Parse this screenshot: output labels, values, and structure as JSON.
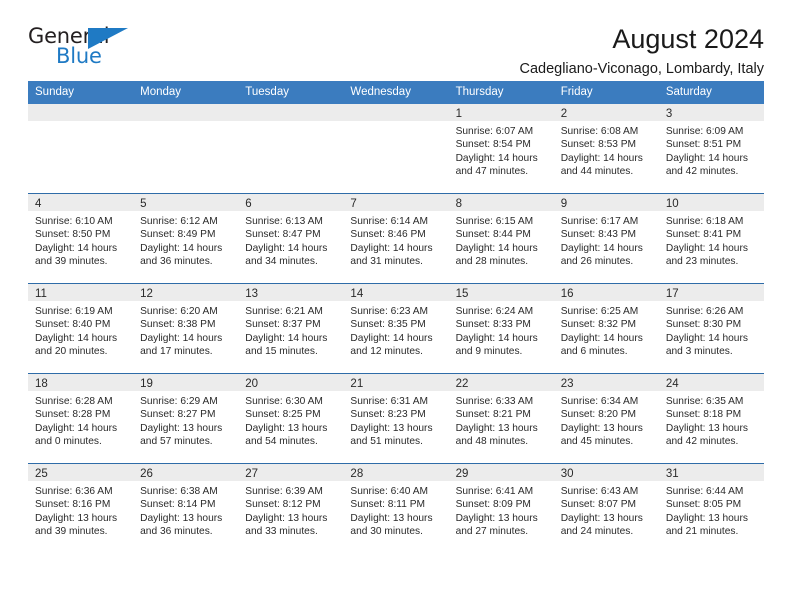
{
  "brand": {
    "name_part1": "General",
    "name_part2": "Blue",
    "flag_icon": "triangle-flag-icon",
    "accent_color": "#1f7ac4"
  },
  "header": {
    "title": "August 2024",
    "subtitle": "Cadegliano-Viconago, Lombardy, Italy"
  },
  "colors": {
    "header_row_bg": "#3b7cbf",
    "daynum_bg": "#ececec",
    "grid_line": "#2f6ca8",
    "text": "#2a2a2a"
  },
  "weekday_headers": [
    "Sunday",
    "Monday",
    "Tuesday",
    "Wednesday",
    "Thursday",
    "Friday",
    "Saturday"
  ],
  "weeks": [
    [
      {
        "day": "",
        "sunrise": "",
        "sunset": "",
        "daylight": "",
        "daylight2": "",
        "empty": true
      },
      {
        "day": "",
        "sunrise": "",
        "sunset": "",
        "daylight": "",
        "daylight2": "",
        "empty": true
      },
      {
        "day": "",
        "sunrise": "",
        "sunset": "",
        "daylight": "",
        "daylight2": "",
        "empty": true
      },
      {
        "day": "",
        "sunrise": "",
        "sunset": "",
        "daylight": "",
        "daylight2": "",
        "empty": true
      },
      {
        "day": "1",
        "sunrise": "Sunrise: 6:07 AM",
        "sunset": "Sunset: 8:54 PM",
        "daylight": "Daylight: 14 hours",
        "daylight2": "and 47 minutes.",
        "empty": false
      },
      {
        "day": "2",
        "sunrise": "Sunrise: 6:08 AM",
        "sunset": "Sunset: 8:53 PM",
        "daylight": "Daylight: 14 hours",
        "daylight2": "and 44 minutes.",
        "empty": false
      },
      {
        "day": "3",
        "sunrise": "Sunrise: 6:09 AM",
        "sunset": "Sunset: 8:51 PM",
        "daylight": "Daylight: 14 hours",
        "daylight2": "and 42 minutes.",
        "empty": false
      }
    ],
    [
      {
        "day": "4",
        "sunrise": "Sunrise: 6:10 AM",
        "sunset": "Sunset: 8:50 PM",
        "daylight": "Daylight: 14 hours",
        "daylight2": "and 39 minutes.",
        "empty": false
      },
      {
        "day": "5",
        "sunrise": "Sunrise: 6:12 AM",
        "sunset": "Sunset: 8:49 PM",
        "daylight": "Daylight: 14 hours",
        "daylight2": "and 36 minutes.",
        "empty": false
      },
      {
        "day": "6",
        "sunrise": "Sunrise: 6:13 AM",
        "sunset": "Sunset: 8:47 PM",
        "daylight": "Daylight: 14 hours",
        "daylight2": "and 34 minutes.",
        "empty": false
      },
      {
        "day": "7",
        "sunrise": "Sunrise: 6:14 AM",
        "sunset": "Sunset: 8:46 PM",
        "daylight": "Daylight: 14 hours",
        "daylight2": "and 31 minutes.",
        "empty": false
      },
      {
        "day": "8",
        "sunrise": "Sunrise: 6:15 AM",
        "sunset": "Sunset: 8:44 PM",
        "daylight": "Daylight: 14 hours",
        "daylight2": "and 28 minutes.",
        "empty": false
      },
      {
        "day": "9",
        "sunrise": "Sunrise: 6:17 AM",
        "sunset": "Sunset: 8:43 PM",
        "daylight": "Daylight: 14 hours",
        "daylight2": "and 26 minutes.",
        "empty": false
      },
      {
        "day": "10",
        "sunrise": "Sunrise: 6:18 AM",
        "sunset": "Sunset: 8:41 PM",
        "daylight": "Daylight: 14 hours",
        "daylight2": "and 23 minutes.",
        "empty": false
      }
    ],
    [
      {
        "day": "11",
        "sunrise": "Sunrise: 6:19 AM",
        "sunset": "Sunset: 8:40 PM",
        "daylight": "Daylight: 14 hours",
        "daylight2": "and 20 minutes.",
        "empty": false
      },
      {
        "day": "12",
        "sunrise": "Sunrise: 6:20 AM",
        "sunset": "Sunset: 8:38 PM",
        "daylight": "Daylight: 14 hours",
        "daylight2": "and 17 minutes.",
        "empty": false
      },
      {
        "day": "13",
        "sunrise": "Sunrise: 6:21 AM",
        "sunset": "Sunset: 8:37 PM",
        "daylight": "Daylight: 14 hours",
        "daylight2": "and 15 minutes.",
        "empty": false
      },
      {
        "day": "14",
        "sunrise": "Sunrise: 6:23 AM",
        "sunset": "Sunset: 8:35 PM",
        "daylight": "Daylight: 14 hours",
        "daylight2": "and 12 minutes.",
        "empty": false
      },
      {
        "day": "15",
        "sunrise": "Sunrise: 6:24 AM",
        "sunset": "Sunset: 8:33 PM",
        "daylight": "Daylight: 14 hours",
        "daylight2": "and 9 minutes.",
        "empty": false
      },
      {
        "day": "16",
        "sunrise": "Sunrise: 6:25 AM",
        "sunset": "Sunset: 8:32 PM",
        "daylight": "Daylight: 14 hours",
        "daylight2": "and 6 minutes.",
        "empty": false
      },
      {
        "day": "17",
        "sunrise": "Sunrise: 6:26 AM",
        "sunset": "Sunset: 8:30 PM",
        "daylight": "Daylight: 14 hours",
        "daylight2": "and 3 minutes.",
        "empty": false
      }
    ],
    [
      {
        "day": "18",
        "sunrise": "Sunrise: 6:28 AM",
        "sunset": "Sunset: 8:28 PM",
        "daylight": "Daylight: 14 hours",
        "daylight2": "and 0 minutes.",
        "empty": false
      },
      {
        "day": "19",
        "sunrise": "Sunrise: 6:29 AM",
        "sunset": "Sunset: 8:27 PM",
        "daylight": "Daylight: 13 hours",
        "daylight2": "and 57 minutes.",
        "empty": false
      },
      {
        "day": "20",
        "sunrise": "Sunrise: 6:30 AM",
        "sunset": "Sunset: 8:25 PM",
        "daylight": "Daylight: 13 hours",
        "daylight2": "and 54 minutes.",
        "empty": false
      },
      {
        "day": "21",
        "sunrise": "Sunrise: 6:31 AM",
        "sunset": "Sunset: 8:23 PM",
        "daylight": "Daylight: 13 hours",
        "daylight2": "and 51 minutes.",
        "empty": false
      },
      {
        "day": "22",
        "sunrise": "Sunrise: 6:33 AM",
        "sunset": "Sunset: 8:21 PM",
        "daylight": "Daylight: 13 hours",
        "daylight2": "and 48 minutes.",
        "empty": false
      },
      {
        "day": "23",
        "sunrise": "Sunrise: 6:34 AM",
        "sunset": "Sunset: 8:20 PM",
        "daylight": "Daylight: 13 hours",
        "daylight2": "and 45 minutes.",
        "empty": false
      },
      {
        "day": "24",
        "sunrise": "Sunrise: 6:35 AM",
        "sunset": "Sunset: 8:18 PM",
        "daylight": "Daylight: 13 hours",
        "daylight2": "and 42 minutes.",
        "empty": false
      }
    ],
    [
      {
        "day": "25",
        "sunrise": "Sunrise: 6:36 AM",
        "sunset": "Sunset: 8:16 PM",
        "daylight": "Daylight: 13 hours",
        "daylight2": "and 39 minutes.",
        "empty": false
      },
      {
        "day": "26",
        "sunrise": "Sunrise: 6:38 AM",
        "sunset": "Sunset: 8:14 PM",
        "daylight": "Daylight: 13 hours",
        "daylight2": "and 36 minutes.",
        "empty": false
      },
      {
        "day": "27",
        "sunrise": "Sunrise: 6:39 AM",
        "sunset": "Sunset: 8:12 PM",
        "daylight": "Daylight: 13 hours",
        "daylight2": "and 33 minutes.",
        "empty": false
      },
      {
        "day": "28",
        "sunrise": "Sunrise: 6:40 AM",
        "sunset": "Sunset: 8:11 PM",
        "daylight": "Daylight: 13 hours",
        "daylight2": "and 30 minutes.",
        "empty": false
      },
      {
        "day": "29",
        "sunrise": "Sunrise: 6:41 AM",
        "sunset": "Sunset: 8:09 PM",
        "daylight": "Daylight: 13 hours",
        "daylight2": "and 27 minutes.",
        "empty": false
      },
      {
        "day": "30",
        "sunrise": "Sunrise: 6:43 AM",
        "sunset": "Sunset: 8:07 PM",
        "daylight": "Daylight: 13 hours",
        "daylight2": "and 24 minutes.",
        "empty": false
      },
      {
        "day": "31",
        "sunrise": "Sunrise: 6:44 AM",
        "sunset": "Sunset: 8:05 PM",
        "daylight": "Daylight: 13 hours",
        "daylight2": "and 21 minutes.",
        "empty": false
      }
    ]
  ]
}
